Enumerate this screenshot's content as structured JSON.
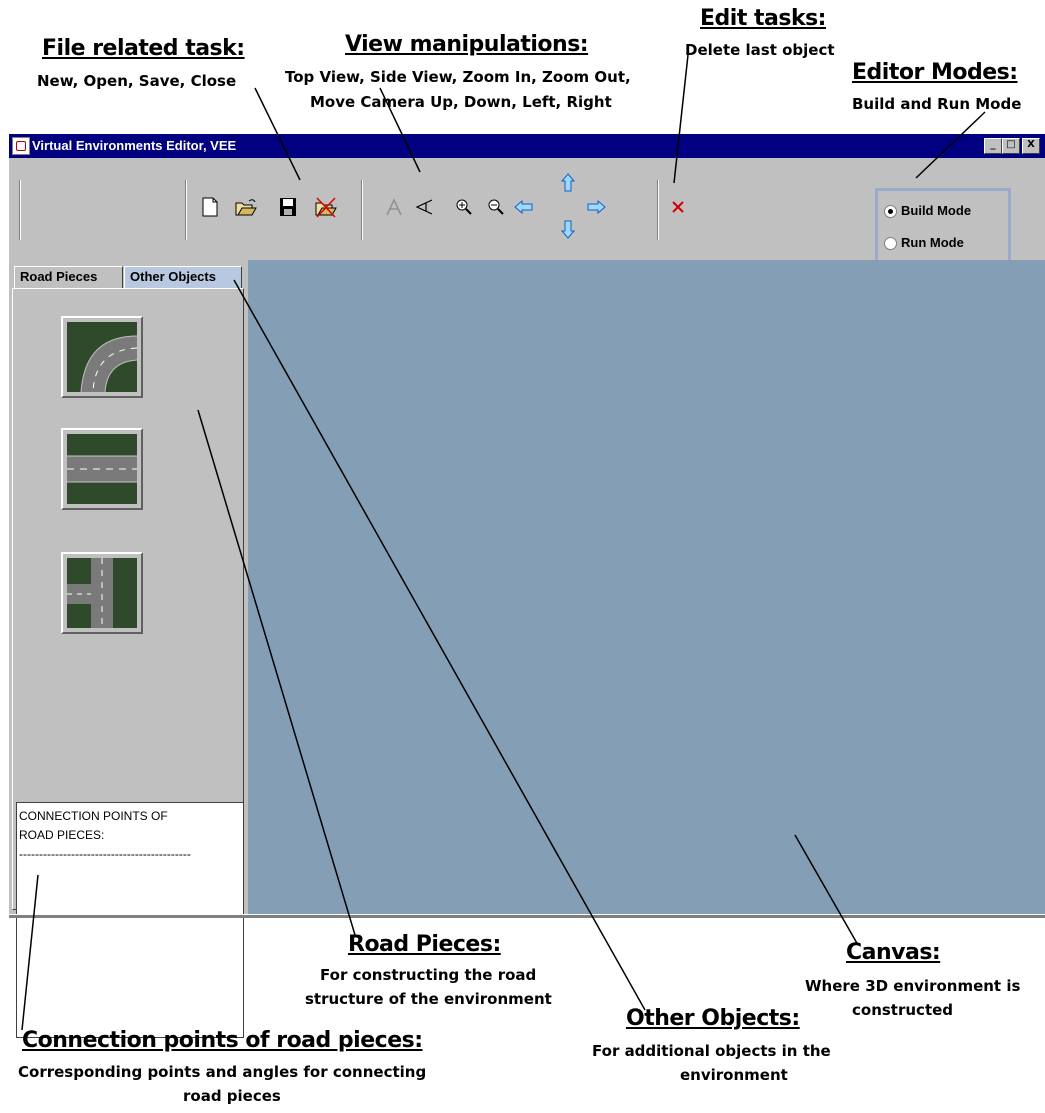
{
  "window": {
    "title": "Virtual Environments Editor, VEE",
    "controls": {
      "minimize": "_",
      "maximize": "□",
      "close": "X"
    }
  },
  "toolbar": {
    "file_buttons": [
      {
        "icon": "new-file-icon"
      },
      {
        "icon": "open-folder-icon"
      },
      {
        "icon": "save-disk-icon"
      },
      {
        "icon": "close-folder-icon"
      }
    ],
    "view_buttons": [
      {
        "icon": "top-view-icon"
      },
      {
        "icon": "side-view-icon"
      },
      {
        "icon": "zoom-in-icon"
      },
      {
        "icon": "zoom-out-icon"
      },
      {
        "icon": "arrow-left-icon"
      },
      {
        "icon": "arrow-up-icon"
      },
      {
        "icon": "arrow-down-icon"
      },
      {
        "icon": "arrow-right-icon"
      }
    ],
    "edit_buttons": [
      {
        "icon": "delete-x-icon"
      }
    ]
  },
  "modes": {
    "build": "Build Mode",
    "run": "Run Mode",
    "selected": "Build Mode"
  },
  "tabs": {
    "road_pieces": "Road Pieces",
    "other_objects": "Other Objects",
    "active": "Road Pieces"
  },
  "road_pieces": [
    {
      "icon": "curved-road-icon"
    },
    {
      "icon": "straight-road-icon"
    },
    {
      "icon": "t-junction-road-icon"
    }
  ],
  "connection_box": {
    "line1": "CONNECTION POINTS OF",
    "line2": "ROAD PIECES:",
    "line3": "-------------------------------------------"
  },
  "annotations": {
    "file": {
      "title": "File related task:",
      "sub": "New, Open, Save, Close"
    },
    "view": {
      "title": "View manipulations:",
      "sub1": "Top View, Side View, Zoom In, Zoom Out,",
      "sub2": "Move Camera Up, Down, Left, Right"
    },
    "edit": {
      "title": "Edit tasks:",
      "sub": "Delete last object"
    },
    "modes": {
      "title": "Editor Modes:",
      "sub": "Build and Run Mode"
    },
    "road": {
      "title": "Road Pieces:",
      "sub1": "For constructing the road",
      "sub2": "structure of the environment"
    },
    "canvas": {
      "title": "Canvas:",
      "sub1": "Where 3D environment is",
      "sub2": "constructed"
    },
    "other": {
      "title": "Other Objects:",
      "sub1": "For  additional objects in the",
      "sub2": "environment"
    },
    "conn": {
      "title": "Connection points of road pieces:",
      "sub1": "Corresponding points and angles for connecting",
      "sub2": "road pieces"
    }
  },
  "colors": {
    "titlebar": "#000080",
    "canvas": "#849eb6",
    "window": "#c0c0c0"
  }
}
